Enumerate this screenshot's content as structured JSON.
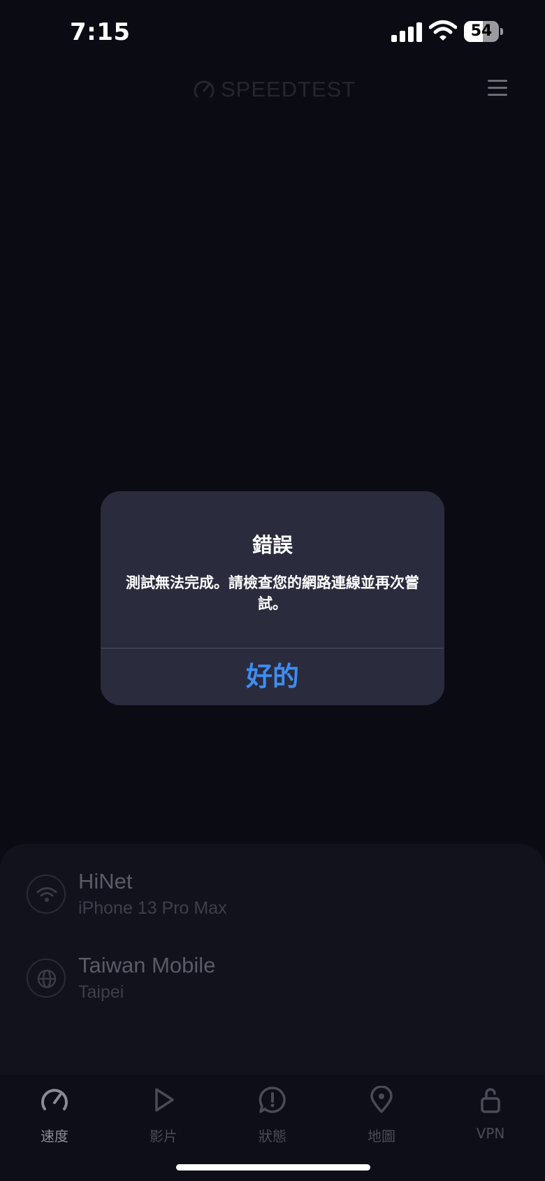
{
  "status_bar": {
    "time": "7:15",
    "battery_level": "54",
    "signal_icon": "cellular-signal-icon",
    "wifi_icon": "wifi-icon"
  },
  "header": {
    "brand": "SPEEDTEST",
    "brand_icon": "speedometer-icon",
    "menu_icon": "hamburger-menu-icon"
  },
  "connection": {
    "isp": {
      "name": "HiNet",
      "device": "iPhone 13 Pro Max",
      "icon": "wifi-icon"
    },
    "server": {
      "name": "Taiwan Mobile",
      "location": "Taipei",
      "icon": "globe-icon"
    }
  },
  "dialog": {
    "title": "錯誤",
    "message": "測試無法完成。請檢查您的網路連線並再次嘗試。",
    "ok_label": "好的"
  },
  "tabs": [
    {
      "label": "速度",
      "icon": "speedometer-icon",
      "active": true
    },
    {
      "label": "影片",
      "icon": "play-icon",
      "active": false
    },
    {
      "label": "狀態",
      "icon": "alert-bubble-icon",
      "active": false
    },
    {
      "label": "地圖",
      "icon": "map-pin-icon",
      "active": false
    },
    {
      "label": "VPN",
      "icon": "unlock-icon",
      "active": false
    }
  ],
  "colors": {
    "background": "#0b0b14",
    "dialog": "#2a2b3d",
    "accent": "#3f8cf0"
  }
}
